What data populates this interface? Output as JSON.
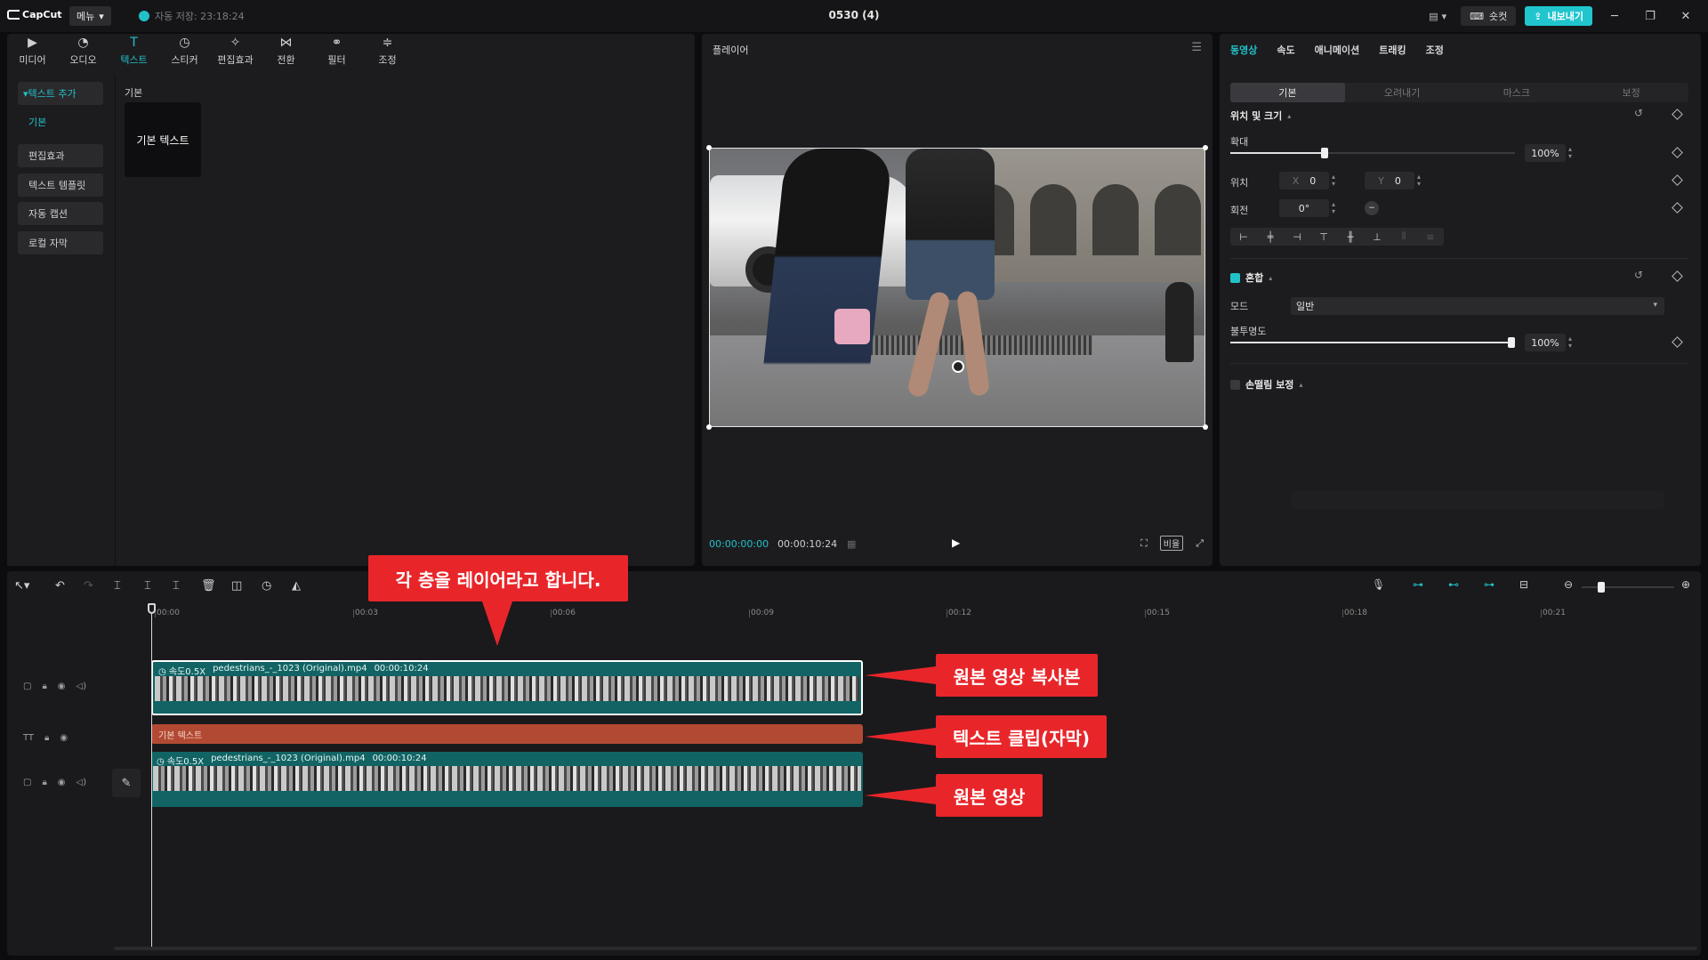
{
  "titlebar": {
    "logo": "CapCut",
    "menu_label": "메뉴",
    "autosave": "자동 저장: 23:18:24",
    "project_title": "0530 (4)",
    "shortcut_label": "숏컷",
    "export_label": "내보내기"
  },
  "tool_tabs": [
    {
      "label": "미디어",
      "icon": "media-icon"
    },
    {
      "label": "오디오",
      "icon": "audio-icon"
    },
    {
      "label": "텍스트",
      "icon": "text-icon"
    },
    {
      "label": "스티커",
      "icon": "sticker-icon"
    },
    {
      "label": "편집효과",
      "icon": "effects-icon"
    },
    {
      "label": "전환",
      "icon": "transition-icon"
    },
    {
      "label": "필터",
      "icon": "filter-icon"
    },
    {
      "label": "조정",
      "icon": "adjust-icon"
    }
  ],
  "left_nav": {
    "group": "텍스트 추가",
    "sub": "기본",
    "items": [
      "편집효과",
      "텍스트 템플릿",
      "자동 캡션",
      "로컬 자막"
    ]
  },
  "library": {
    "section": "기본",
    "card": "기본 텍스트"
  },
  "player": {
    "title": "플레이어",
    "current_time": "00:00:00:00",
    "total_time": "00:00:10:24",
    "ratio_label": "비율"
  },
  "props": {
    "tabs": [
      "동영상",
      "속도",
      "애니메이션",
      "트래킹",
      "조정"
    ],
    "segments": [
      "기본",
      "오려내기",
      "마스크",
      "보정"
    ],
    "position_size_title": "위치 및 크기",
    "scale_label": "확대",
    "scale_value": "100%",
    "scale_level": 0.32,
    "position_label": "위치",
    "x_prefix": "X",
    "x_value": "0",
    "y_prefix": "Y",
    "y_value": "0",
    "rotation_label": "회전",
    "rotation_value": "0°",
    "blend_title": "혼합",
    "mode_label": "모드",
    "mode_value": "일반",
    "opacity_label": "불투명도",
    "opacity_value": "100%",
    "opacity_level": 1.0,
    "stabilize_title": "손떨림 보정"
  },
  "timeline": {
    "ruler": [
      "00:00",
      "00:03",
      "00:06",
      "00:09",
      "00:12",
      "00:15",
      "00:18",
      "00:21"
    ],
    "clip_speed": "속도0.5X",
    "clip_name": "pedestrians_-_1023 (Original).mp4",
    "clip_duration": "00:00:10:24",
    "text_clip": "기본 텍스트"
  },
  "annotations": {
    "layers": "각 층을 레이어라고 합니다.",
    "copy": "원본 영상 복사본",
    "text_clip": "텍스트 클립(자막)",
    "original": "원본 영상"
  }
}
